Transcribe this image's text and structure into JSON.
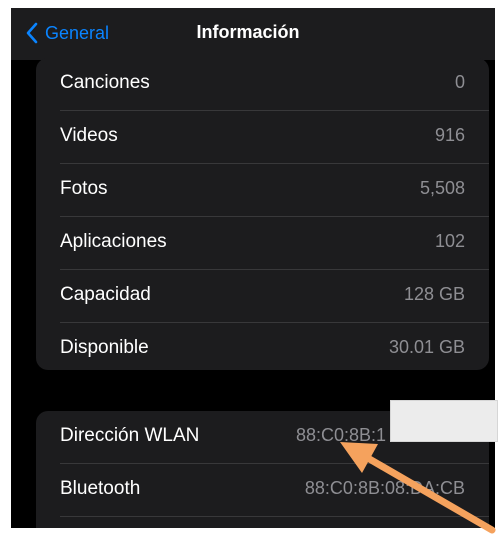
{
  "nav": {
    "back_label": "General",
    "title": "Información"
  },
  "info_rows": [
    {
      "label": "Canciones",
      "value": "0"
    },
    {
      "label": "Videos",
      "value": "916"
    },
    {
      "label": "Fotos",
      "value": "5,508"
    },
    {
      "label": "Aplicaciones",
      "value": "102"
    },
    {
      "label": "Capacidad",
      "value": "128 GB"
    },
    {
      "label": "Disponible",
      "value": "30.01 GB"
    }
  ],
  "network_rows": [
    {
      "label": "Dirección WLAN",
      "value": "88:C0:8B:1"
    },
    {
      "label": "Bluetooth",
      "value": "88:C0:8B:08:DA:CB"
    }
  ],
  "colors": {
    "accent": "#0a84ff",
    "annotation_arrow": "#f5a25d"
  }
}
